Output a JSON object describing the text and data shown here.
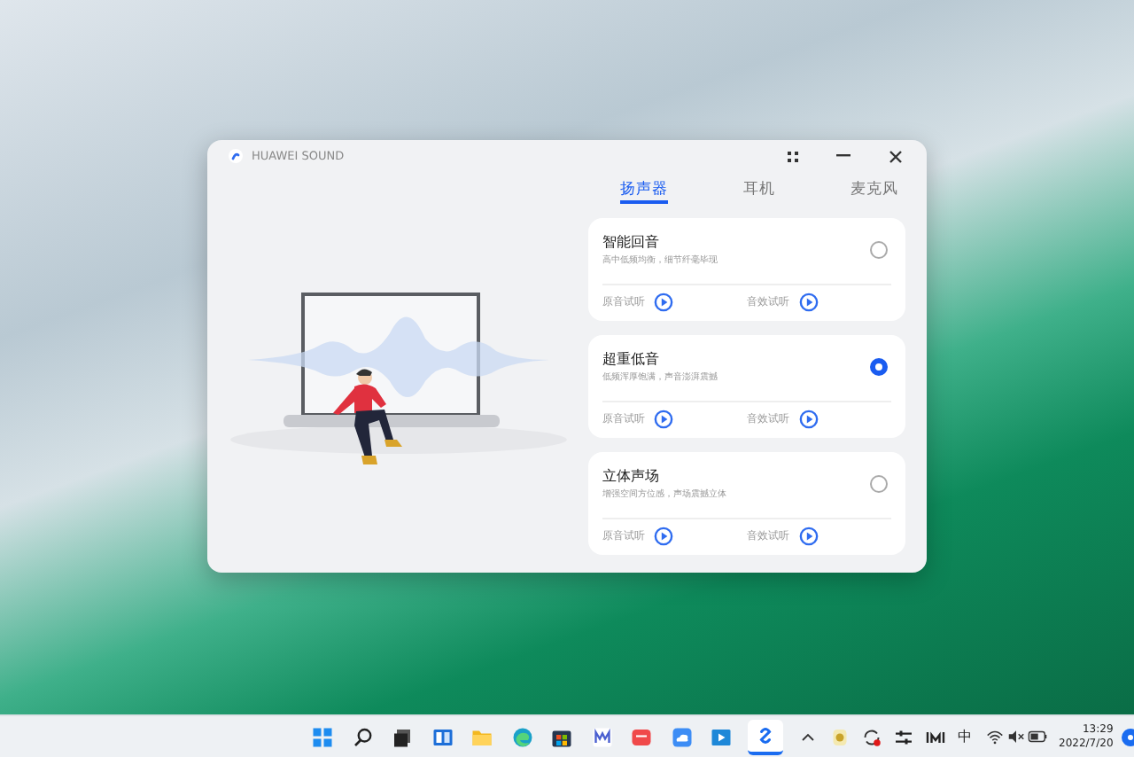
{
  "window": {
    "title": "HUAWEI SOUND"
  },
  "tabs": [
    {
      "label": "扬声器",
      "selected": true
    },
    {
      "label": "耳机",
      "selected": false
    },
    {
      "label": "麦克风",
      "selected": false
    }
  ],
  "modes": [
    {
      "name": "智能回音",
      "description": "高中低频均衡，细节纤毫毕现",
      "selected": false,
      "original_label": "原音试听",
      "effect_label": "音效试听"
    },
    {
      "name": "超重低音",
      "description": "低频浑厚饱满，声音澎湃震撼",
      "selected": true,
      "original_label": "原音试听",
      "effect_label": "音效试听"
    },
    {
      "name": "立体声场",
      "description": "增强空间方位感，声场震撼立体",
      "selected": false,
      "original_label": "原音试听",
      "effect_label": "音效试听"
    }
  ],
  "taskbar": {
    "input_method": "中",
    "time": "13:29",
    "date": "2022/7/20"
  }
}
